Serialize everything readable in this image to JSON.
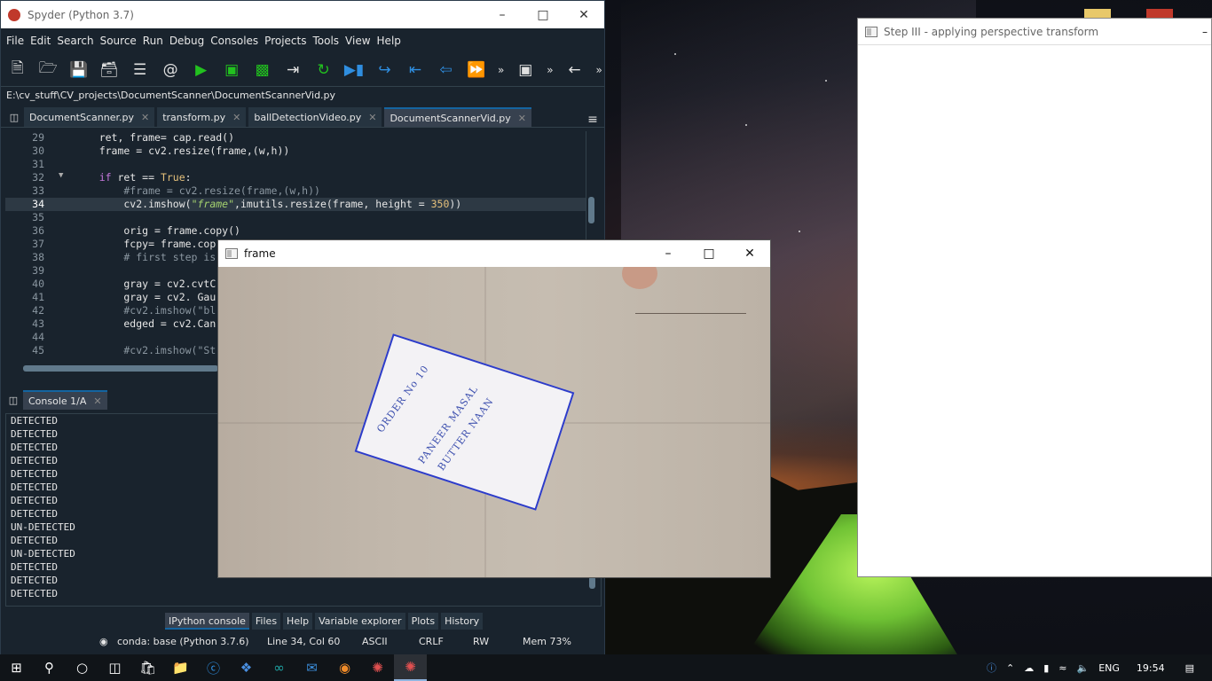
{
  "spyder": {
    "title": "Spyder (Python 3.7)",
    "menu": [
      "File",
      "Edit",
      "Search",
      "Source",
      "Run",
      "Debug",
      "Consoles",
      "Projects",
      "Tools",
      "View",
      "Help"
    ],
    "path": "E:\\cv_stuff\\CV_projects\\DocumentScanner\\DocumentScannerVid.py",
    "tabs": [
      "DocumentScanner.py",
      "transform.py",
      "ballDetectionVideo.py",
      "DocumentScannerVid.py"
    ],
    "active_tab": "DocumentScannerVid.py",
    "code": [
      {
        "n": "29",
        "text": "    ret, frame= cap.read()"
      },
      {
        "n": "30",
        "text": "    frame = cv2.resize(frame,(w,h))"
      },
      {
        "n": "31",
        "text": ""
      },
      {
        "n": "32",
        "text": "    if ret == True:"
      },
      {
        "n": "33",
        "text": "        #frame = cv2.resize(frame,(w,h))"
      },
      {
        "n": "34",
        "text": "        cv2.imshow(\"frame\",imutils.resize(frame, height = 350))"
      },
      {
        "n": "35",
        "text": ""
      },
      {
        "n": "36",
        "text": "        orig = frame.copy()"
      },
      {
        "n": "37",
        "text": "        fcpy= frame.cop"
      },
      {
        "n": "38",
        "text": "        # first step is"
      },
      {
        "n": "39",
        "text": ""
      },
      {
        "n": "40",
        "text": "        gray = cv2.cvtC"
      },
      {
        "n": "41",
        "text": "        gray = cv2. Gau"
      },
      {
        "n": "42",
        "text": "        #cv2.imshow(\"bl"
      },
      {
        "n": "43",
        "text": "        edged = cv2.Can"
      },
      {
        "n": "44",
        "text": ""
      },
      {
        "n": "45",
        "text": "        #cv2.imshow(\"St"
      }
    ],
    "console_tab": "Console 1/A",
    "console_lines": [
      "DETECTED",
      "DETECTED",
      "DETECTED",
      "DETECTED",
      "DETECTED",
      "DETECTED",
      "DETECTED",
      "DETECTED",
      "UN-DETECTED",
      "DETECTED",
      "UN-DETECTED",
      "DETECTED",
      "DETECTED",
      "DETECTED"
    ],
    "bottom_tabs": [
      "IPython console",
      "Files",
      "Help",
      "Variable explorer",
      "Plots",
      "History"
    ],
    "status": {
      "env": "conda: base (Python 3.7.6)",
      "position": "Line 34, Col 60",
      "encoding": "ASCII",
      "eol": "CRLF",
      "perm": "RW",
      "mem": "Mem 73%"
    }
  },
  "step3": {
    "title": "Step III - applying perspective transform"
  },
  "frame": {
    "title": "frame",
    "note_lines": [
      "ORDER No 10",
      "PANEER MASAL",
      "BUTTER NAAN"
    ]
  },
  "taskbar": {
    "lang": "ENG",
    "time": "19:54"
  },
  "colors": {
    "accent": "#1464a0",
    "run_green": "#22c11f",
    "ink_blue": "#2d3cc9"
  }
}
